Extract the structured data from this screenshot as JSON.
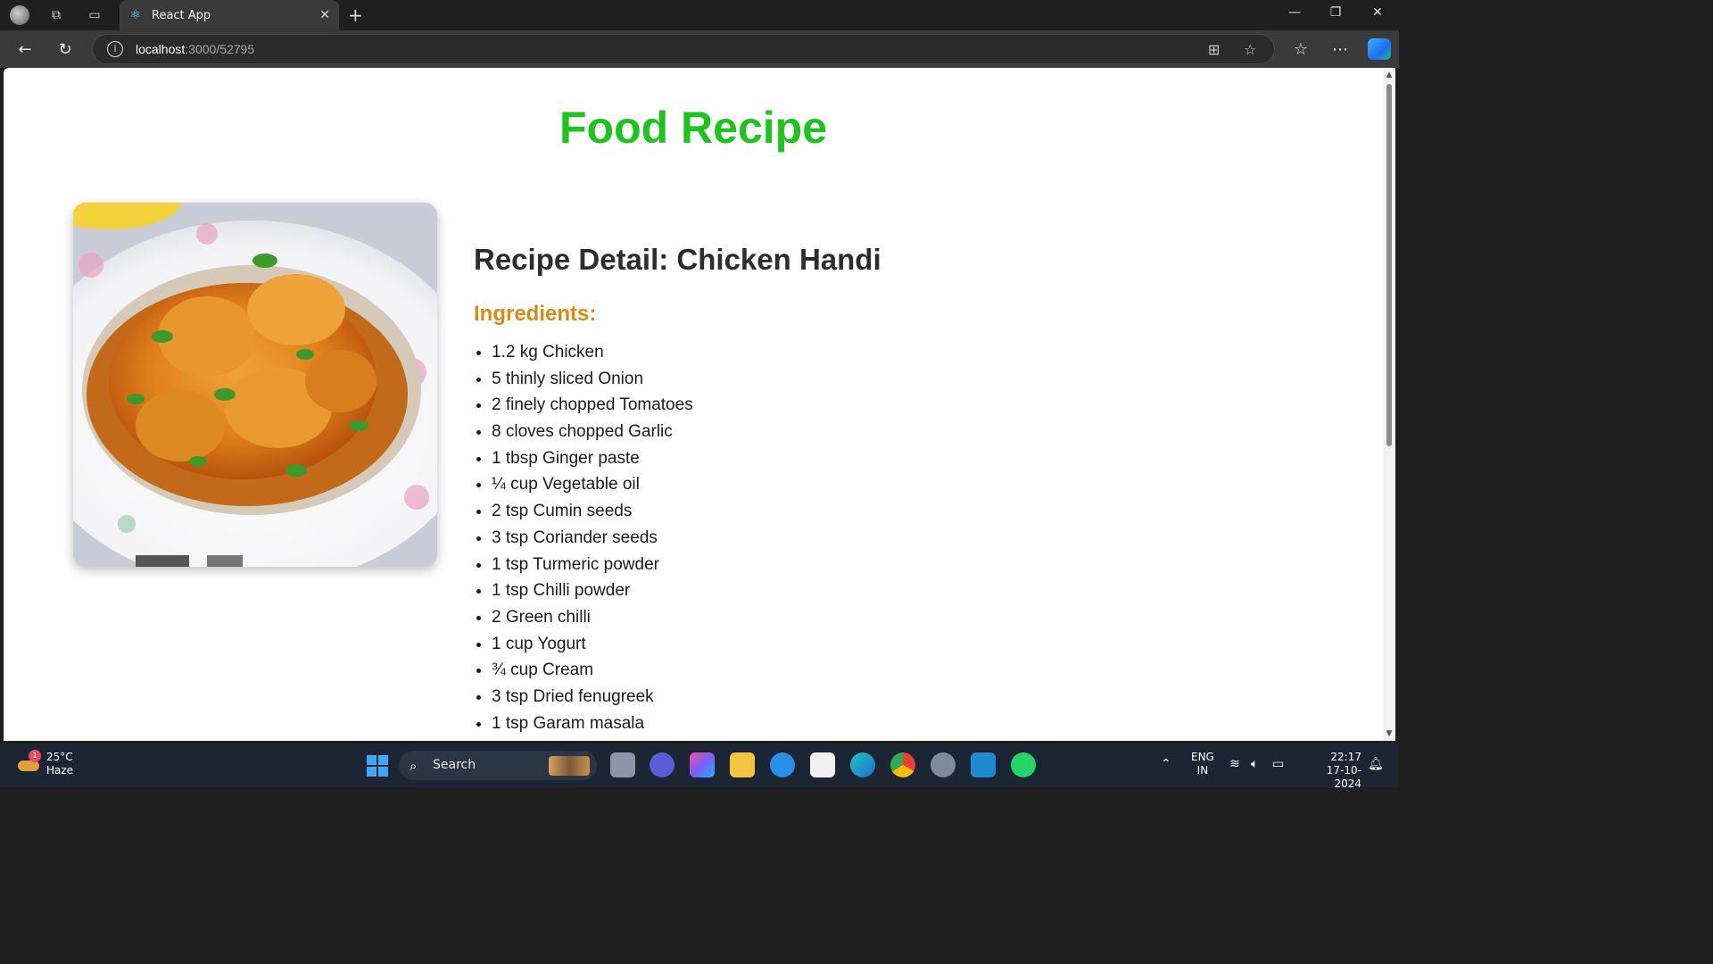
{
  "browser": {
    "tab_title": "React App",
    "url_host": "localhost",
    "url_rest": ":3000/52795"
  },
  "page": {
    "title": "Food Recipe",
    "detail_title": "Recipe Detail: Chicken Handi",
    "ingredients_heading": "Ingredients:",
    "ingredients": [
      "1.2 kg Chicken",
      "5 thinly sliced Onion",
      "2 finely chopped Tomatoes",
      "8 cloves chopped Garlic",
      "1 tbsp Ginger paste",
      "¼ cup Vegetable oil",
      "2 tsp Cumin seeds",
      "3 tsp Coriander seeds",
      "1 tsp Turmeric powder",
      "1 tsp Chilli powder",
      "2 Green chilli",
      "1 cup Yogurt",
      "¾ cup Cream",
      "3 tsp Dried fenugreek",
      "1 tsp Garam masala"
    ]
  },
  "taskbar": {
    "weather_temp": "25°C",
    "weather_desc": "Haze",
    "weather_badge": "1",
    "search_label": "Search",
    "lang_top": "ENG",
    "lang_bottom": "IN",
    "time": "22:17",
    "date": "17-10-2024"
  }
}
